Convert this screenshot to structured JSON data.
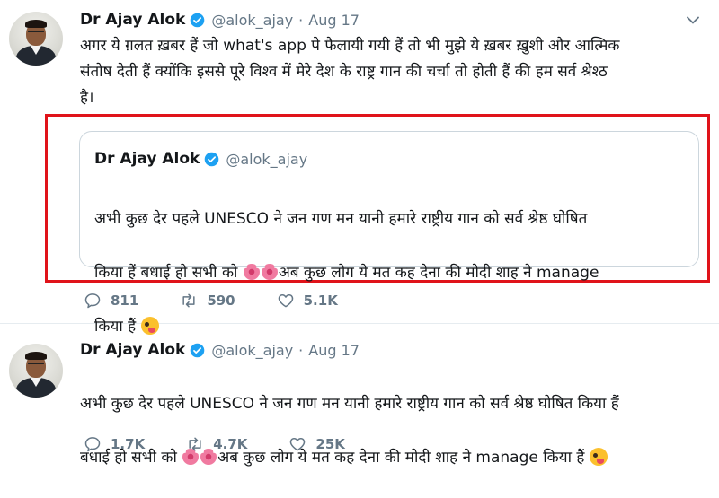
{
  "tweets": [
    {
      "author_name": "Dr Ajay Alok",
      "handle": "@alok_ajay",
      "separator": "·",
      "date": "Aug 17",
      "text": "अगर ये ग़लत ख़बर हैं जो what's app पे फैलायी गयी हैं तो भी मुझे ये ख़बर ख़ुशी और आत्मिक\nसंतोष देती हैं क्योंकि इससे पूरे विश्व में मेरे देश के राष्ट्र गान की चर्चा तो होती हैं की हम सर्व श्रेश्ठ\nहै।",
      "quoted": {
        "author_name": "Dr Ajay Alok",
        "handle": "@alok_ajay",
        "text_line1": "अभी कुछ देर पहले UNESCO ने जन गण मन यानी हमारे राष्ट्रीय गान को सर्व श्रेष्ठ घोषित",
        "text_line2_before": "किया हैं बधाई हो सभी को",
        "text_line2_after": "अब कुछ लोग ये मत कह देना की मोदी शाह ने manage",
        "text_line3": "किया हैं"
      },
      "stats": {
        "replies": "811",
        "retweets": "590",
        "likes": "5.1K"
      }
    },
    {
      "author_name": "Dr Ajay Alok",
      "handle": "@alok_ajay",
      "separator": "·",
      "date": "Aug 17",
      "text_line1": "अभी कुछ देर पहले UNESCO ने जन गण मन यानी हमारे राष्ट्रीय गान को सर्व श्रेष्ठ घोषित किया हैं",
      "text_line2_before": "बधाई हो सभी को",
      "text_line2_after": "अब कुछ लोग ये मत कह देना की मोदी शाह ने manage किया हैं",
      "stats": {
        "replies": "1.7K",
        "retweets": "4.7K",
        "likes": "25K"
      }
    }
  ],
  "icons": {
    "verified": "verified-badge-icon",
    "chevron": "chevron-down-icon",
    "reply": "reply-icon",
    "retweet": "retweet-icon",
    "like": "heart-icon",
    "flower": "hibiscus-emoji",
    "wink": "winking-face-emoji"
  },
  "colors": {
    "verified_blue": "#1da1f2",
    "secondary_text": "#657786",
    "highlight_red": "#e0131a",
    "card_border": "#ccd6dd"
  }
}
